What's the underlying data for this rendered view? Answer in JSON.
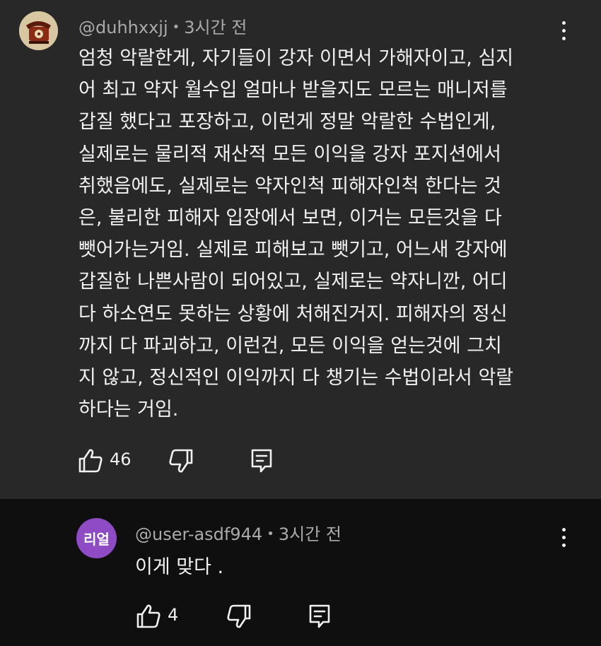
{
  "main_comment": {
    "username": "@duhhxxjj",
    "separator": "•",
    "time": "3시간 전",
    "lines": [
      "엄청 악랄한게, 자기들이 강자 이면서 가해자이고, 심지",
      "어 최고 약자 월수입 얼마나 받을지도 모르는 매니저를",
      "갑질 했다고 포장하고, 이런게 정말 악랄한 수법인게,",
      "실제로는 물리적 재산적 모든 이익을 강자 포지션에서",
      "취했음에도, 실제로는 약자인척 피해자인척 한다는 것",
      "은, 불리한 피해자 입장에서 보면, 이거는 모든것을 다",
      "뺏어가는거임. 실제로 피해보고 뺏기고, 어느새 강자에",
      "갑질한 나쁜사람이 되어있고, 실제로는 약자니깐, 어디",
      "다 하소연도 못하는 상황에 처해진거지. 피해자의 정신",
      "까지 다 파괴하고, 이런건, 모든 이익을 얻는것에 그치",
      "지 않고, 정신적인 이익까지 다 챙기는 수법이라서 악랄",
      "하다는 거임."
    ],
    "like_count": "46"
  },
  "reply_comment": {
    "avatar_text": "리얼",
    "avatar_color": "#8e4bc4",
    "username": "@user-asdf944",
    "separator": "•",
    "time": "3시간 전",
    "text": "이게 맞다 .",
    "like_count": "4"
  },
  "colors": {
    "main_bg": "#282828",
    "reply_bg": "#0f0f0f",
    "text": "#f1f1f1",
    "meta": "#aaaaaa"
  },
  "icons": {
    "like": "thumb-up-icon",
    "dislike": "thumb-down-icon",
    "reply": "reply-icon",
    "more": "more-vert-icon"
  }
}
